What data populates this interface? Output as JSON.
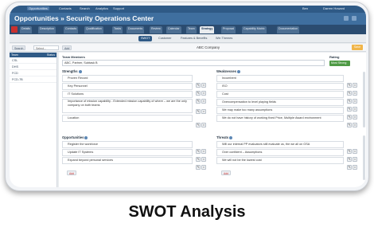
{
  "topnav": {
    "items": [
      "Opportunities",
      "Contacts",
      "Search",
      "Analytics",
      "Support"
    ],
    "user": "Ben",
    "user_name": "Darren Howard"
  },
  "page": {
    "title": "Opportunities » Security Operations Center"
  },
  "tabs": [
    "Details",
    "Description",
    "Contacts",
    "Qualification",
    "Tasks",
    "Documents",
    "Review",
    "Calendar",
    "Team",
    "Strategy",
    "Proposal",
    "Capability Matrix",
    "Documentation"
  ],
  "active_tab": "Strategy",
  "subtabs": [
    "SWOT",
    "Customer",
    "Features & Benefits",
    "Win Themes"
  ],
  "toolbar": {
    "search_label": "Search",
    "select_placeholder": "Select...",
    "add_label": "Add",
    "company": "ABC Company",
    "action_label": "Save"
  },
  "left_panel": {
    "header_left": "Team",
    "header_right": "Status",
    "items": [
      "CSL",
      "DHS",
      "FCD",
      "FCD-7B"
    ]
  },
  "team_members": {
    "label": "Team Members",
    "value": "ABC, Partner, Subtask B"
  },
  "rating": {
    "label": "Rating",
    "value": "Most Strong"
  },
  "strengths": {
    "title": "Strengths",
    "items": [
      "Proven Record",
      "Key Personnel",
      "IT Solutions",
      "Importance of mission capability - Extended mission capability of where – we are the only company on both teams",
      "Location"
    ]
  },
  "weaknesses": {
    "title": "Weaknesses",
    "items": [
      "Incumbent",
      "ISO",
      "Cost",
      "Overcompensation to level playing fields",
      "We may make too many assumptions",
      "We do not have history of working fixed Price, Multiple Award environment"
    ]
  },
  "opportunities": {
    "title": "Opportunities",
    "items": [
      "Register the workforce",
      "Update IT Systems",
      "Expand beyond personal services"
    ]
  },
  "threats": {
    "title": "Threats",
    "items": [
      "Will our internal PP evaluators still evaluate us, the we all on GSA",
      "Over confident – Assumptions",
      "We will not be the lowest cost"
    ]
  },
  "add_button": "Add",
  "caption": "SWOT Analysis"
}
